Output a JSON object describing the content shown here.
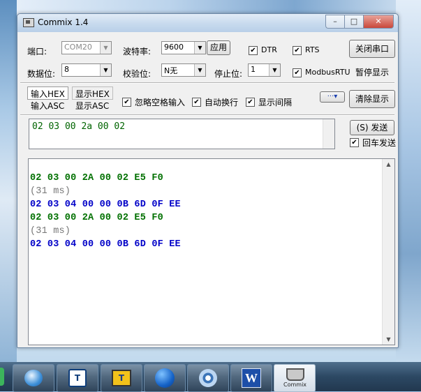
{
  "window": {
    "title": "Commix 1.4",
    "minimize": "–",
    "maximize": "□",
    "close": "✕"
  },
  "row1": {
    "port_label": "端口:",
    "port_value": "COM20",
    "baud_label": "波特率:",
    "baud_value": "9600",
    "apply_button": "应用",
    "dtr_label": "DTR",
    "dtr_checked": "✔",
    "rts_label": "RTS",
    "rts_checked": "✔",
    "close_port_button": "关闭串口"
  },
  "row2": {
    "databits_label": "数据位:",
    "databits_value": "8",
    "parity_label": "校验位:",
    "parity_value": "N无",
    "stopbits_label": "停止位:",
    "stopbits_value": "1",
    "modbus_label": "ModbusRTU",
    "modbus_checked": "✔",
    "pause_display": "暂停显示"
  },
  "row3": {
    "input_hex": "输入HEX",
    "input_asc": "输入ASC",
    "show_hex": "显示HEX",
    "show_asc": "显示ASC",
    "ignore_space": "忽略空格输入",
    "ignore_space_checked": "✔",
    "auto_wrap": "自动换行",
    "auto_wrap_checked": "✔",
    "show_interval": "显示间隔",
    "show_interval_checked": "✔",
    "more_button": "···▾",
    "clear_display": "清除显示"
  },
  "send": {
    "text": "02 03 00 2a 00 02",
    "send_button": "(S) 发送",
    "cr_send_label": "回车发送",
    "cr_send_checked": "✔"
  },
  "receive": {
    "lines": [
      {
        "kind": "tx",
        "text": "02 03 00 2A 00 02 E5 F0"
      },
      {
        "kind": "tm",
        "text": "(31 ms)"
      },
      {
        "kind": "rx",
        "text": "02 03 04 00 00 0B 6D 0F EE"
      },
      {
        "kind": "tx",
        "text": "02 03 00 2A 00 02 E5 F0"
      },
      {
        "kind": "tm",
        "text": "(31 ms)"
      },
      {
        "kind": "rx",
        "text": "02 03 04 00 00 0B 6D 0F EE"
      }
    ]
  },
  "taskbar": {
    "items": [
      {
        "name": "qq-app-icon"
      },
      {
        "name": "text-app-icon",
        "glyph": "T"
      },
      {
        "name": "text-app-icon-2",
        "glyph": "T"
      },
      {
        "name": "globe-app-icon"
      },
      {
        "name": "network-app-icon"
      },
      {
        "name": "word-app-icon",
        "glyph": "W"
      },
      {
        "name": "commix-app-icon",
        "caption": "Commix"
      }
    ]
  },
  "colors": {
    "tx": "#007000",
    "rx": "#0000c8",
    "time": "#777777"
  }
}
